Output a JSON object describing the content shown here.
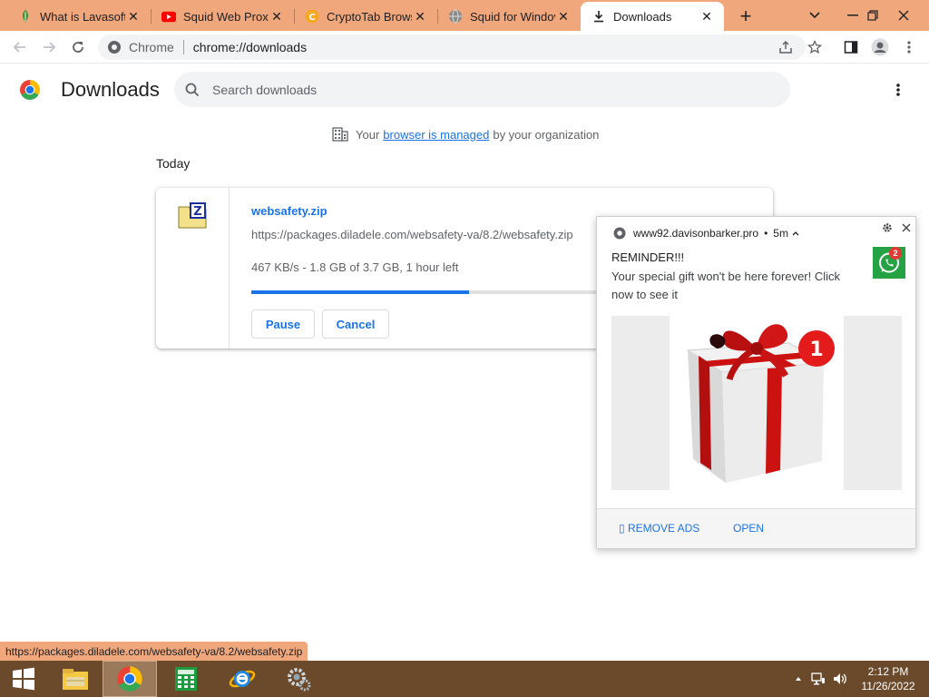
{
  "tabs": [
    {
      "title": "What is Lavasoft",
      "icon": "lavasoft-favicon-icon"
    },
    {
      "title": "Squid Web Proxy",
      "icon": "youtube-favicon-icon"
    },
    {
      "title": "CryptoTab Brows",
      "icon": "cryptotab-favicon-icon"
    },
    {
      "title": "Squid for Windov",
      "icon": "globe-favicon-icon"
    },
    {
      "title": "Downloads",
      "icon": "download-favicon-icon",
      "active": true
    }
  ],
  "omnibox": {
    "chip": "Chrome",
    "url": "chrome://downloads"
  },
  "downloads_page": {
    "title": "Downloads",
    "search_placeholder": "Search downloads",
    "managed_prefix": "Your",
    "managed_link": "browser is managed",
    "managed_suffix": "by your organization",
    "date_heading": "Today"
  },
  "download_item": {
    "filename": "websafety.zip",
    "url": "https://packages.diladele.com/websafety-va/8.2/websafety.zip",
    "status": "467 KB/s - 1.8 GB of 3.7 GB, 1 hour left",
    "progress_fraction": 0.44,
    "pause_label": "Pause",
    "cancel_label": "Cancel"
  },
  "notification": {
    "origin": "www92.davisonbarker.pro",
    "bullet": "•",
    "age": "5m",
    "title": "REMINDER!!!",
    "body": "Your special gift won't be here forever! Click now to see it",
    "badge_count": "2",
    "image_badge": "1",
    "remove_ads_label": "▯ REMOVE ADS",
    "open_label": "OPEN"
  },
  "status_bubble": "https://packages.diladele.com/websafety-va/8.2/websafety.zip",
  "taskbar": {
    "apps": [
      "start-button",
      "file-explorer",
      "chrome",
      "calculator",
      "internet-explorer",
      "settings"
    ],
    "time": "2:12 PM",
    "date": "11/26/2022"
  },
  "colors": {
    "tabstrip": "#f0a77b",
    "accent": "#1a73e8",
    "taskbar": "#6b4a2b"
  }
}
